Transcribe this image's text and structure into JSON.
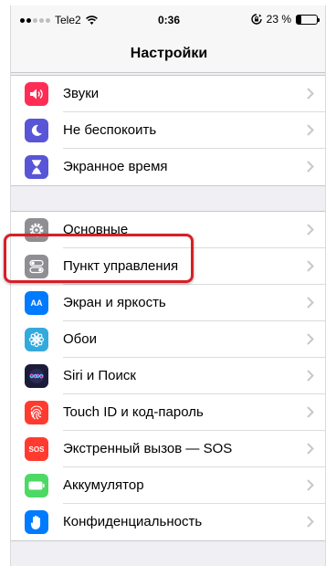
{
  "status_bar": {
    "carrier": "Tele2",
    "time": "0:36",
    "battery": "23 %",
    "battery_level": 0.23
  },
  "nav": {
    "title": "Настройки"
  },
  "groups": [
    {
      "items": [
        {
          "label": "Звуки",
          "icon": "speaker-icon",
          "color": "#ff2d55"
        },
        {
          "label": "Не беспокоить",
          "icon": "moon-icon",
          "color": "#5856d6"
        },
        {
          "label": "Экранное время",
          "icon": "hourglass-icon",
          "color": "#5856d6"
        }
      ]
    },
    {
      "items": [
        {
          "label": "Основные",
          "icon": "gear-icon",
          "color": "#8e8e93"
        },
        {
          "label": "Пункт управления",
          "icon": "toggles-icon",
          "color": "#8e8e93"
        },
        {
          "label": "Экран и яркость",
          "icon": "text-size-icon",
          "glyph": "AA",
          "color": "#007aff"
        },
        {
          "label": "Обои",
          "icon": "flower-icon",
          "color": "#34aadc"
        },
        {
          "label": "Siri и Поиск",
          "icon": "siri-icon",
          "color": "#1c1c3a"
        },
        {
          "label": "Touch ID и код-пароль",
          "icon": "fingerprint-icon",
          "color": "#ff3b30"
        },
        {
          "label": "Экстренный вызов — SOS",
          "icon": "sos-icon",
          "glyph": "SOS",
          "color": "#ff3b30"
        },
        {
          "label": "Аккумулятор",
          "icon": "battery-icon",
          "color": "#4cd964"
        },
        {
          "label": "Конфиденциальность",
          "icon": "hand-icon",
          "color": "#007aff"
        }
      ]
    }
  ]
}
